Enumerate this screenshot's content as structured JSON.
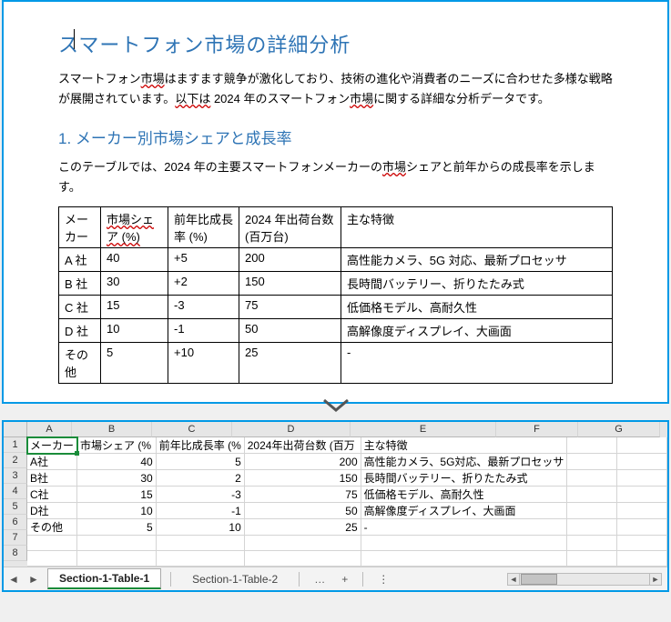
{
  "doc": {
    "title": "スマートフォン市場の詳細分析",
    "intro_plain_a": "スマートフォン",
    "intro_wavy_a": "市場",
    "intro_plain_b": "はますます競争が激化しており、技術の進化や消費者のニーズに合わせた多様な戦略が展開されています。",
    "intro_wavy_b": "以下は",
    "intro_plain_c": " 2024 年のスマートフォン",
    "intro_wavy_c": "市場",
    "intro_plain_d": "に関する詳細な分析データです。",
    "heading1": "1. メーカー別市場シェアと成長率",
    "para1_a": "このテーブルでは、2024 年の主要スマートフォンメーカーの",
    "para1_w": "市場",
    "para1_b": "シェアと前年からの成長率を示します。",
    "table_headers": [
      "メーカー",
      "市場シェア (%)",
      "前年比成長率 (%)",
      "2024 年出荷台数 (百万台)",
      "主な特徴"
    ],
    "rows": [
      {
        "maker": "A 社",
        "share": "40",
        "growth": "+5",
        "ship": "200",
        "feat": "高性能カメラ、5G 対応、最新プロセッサ"
      },
      {
        "maker": "B 社",
        "share": "30",
        "growth": "+2",
        "ship": "150",
        "feat": "長時間バッテリー、折りたたみ式"
      },
      {
        "maker": "C 社",
        "share": "15",
        "growth": "-3",
        "ship": "75",
        "feat": "低価格モデル、高耐久性"
      },
      {
        "maker": "D 社",
        "share": "10",
        "growth": "-1",
        "ship": "50",
        "feat": "高解像度ディスプレイ、大画面"
      },
      {
        "maker": "その他",
        "share": "5",
        "growth": "+10",
        "ship": "25",
        "feat": "-"
      }
    ]
  },
  "sheet": {
    "col_labels": [
      "A",
      "B",
      "C",
      "D",
      "E",
      "F",
      "G"
    ],
    "row_labels": [
      "1",
      "2",
      "3",
      "4",
      "5",
      "6",
      "7",
      "8"
    ],
    "header_row": [
      "メーカー",
      "市場シェア (%",
      "前年比成長率 (%",
      "2024年出荷台数 (百万",
      "主な特徴"
    ],
    "rows": [
      {
        "a": "A社",
        "b": "40",
        "c": "5",
        "d": "200",
        "e": "高性能カメラ、5G対応、最新プロセッサ"
      },
      {
        "a": "B社",
        "b": "30",
        "c": "2",
        "d": "150",
        "e": "長時間バッテリー、折りたたみ式"
      },
      {
        "a": "C社",
        "b": "15",
        "c": "-3",
        "d": "75",
        "e": "低価格モデル、高耐久性"
      },
      {
        "a": "D社",
        "b": "10",
        "c": "-1",
        "d": "50",
        "e": "高解像度ディスプレイ、大画面"
      },
      {
        "a": "その他",
        "b": "5",
        "c": "10",
        "d": "25",
        "e": "-"
      }
    ],
    "tabs": {
      "active": "Section-1-Table-1",
      "other": "Section-1-Table-2",
      "more": "…",
      "add": "+",
      "menu": "⋮"
    }
  }
}
